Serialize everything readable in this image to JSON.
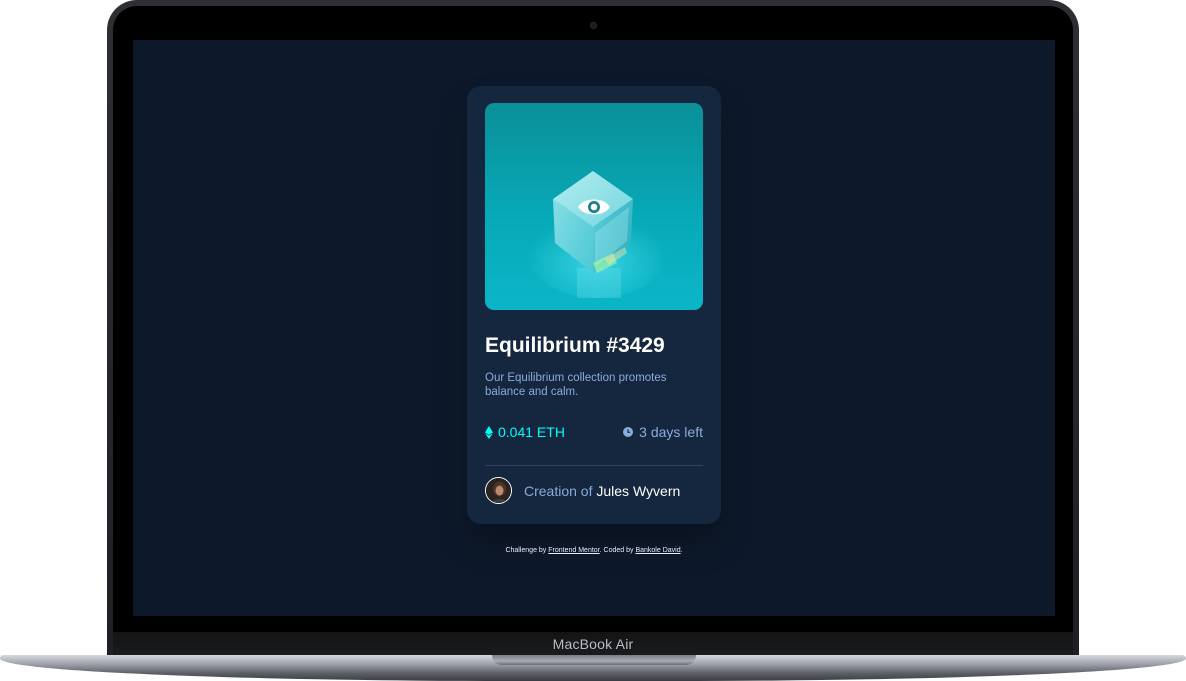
{
  "device": {
    "label": "MacBook Air"
  },
  "card": {
    "title": "Equilibrium #3429",
    "description": "Our Equilibrium collection promotes balance and calm.",
    "price": "0.041 ETH",
    "time_left": "3 days left",
    "creator_prefix": "Creation of",
    "creator_name": "Jules Wyvern",
    "image_overlay_icon": "eye-icon",
    "price_icon": "ethereum-icon",
    "time_icon": "clock-icon"
  },
  "attribution": {
    "prefix": "Challenge by",
    "challenge_link": "Frontend Mentor",
    "middle": ". Coded by",
    "author_link": "Bankole David",
    "suffix": "."
  },
  "colors": {
    "background": "#0d192b",
    "card": "#15263f",
    "cyan_accent": "#00fff8",
    "soft_blue": "#8bacd9",
    "white": "#ffffff"
  }
}
